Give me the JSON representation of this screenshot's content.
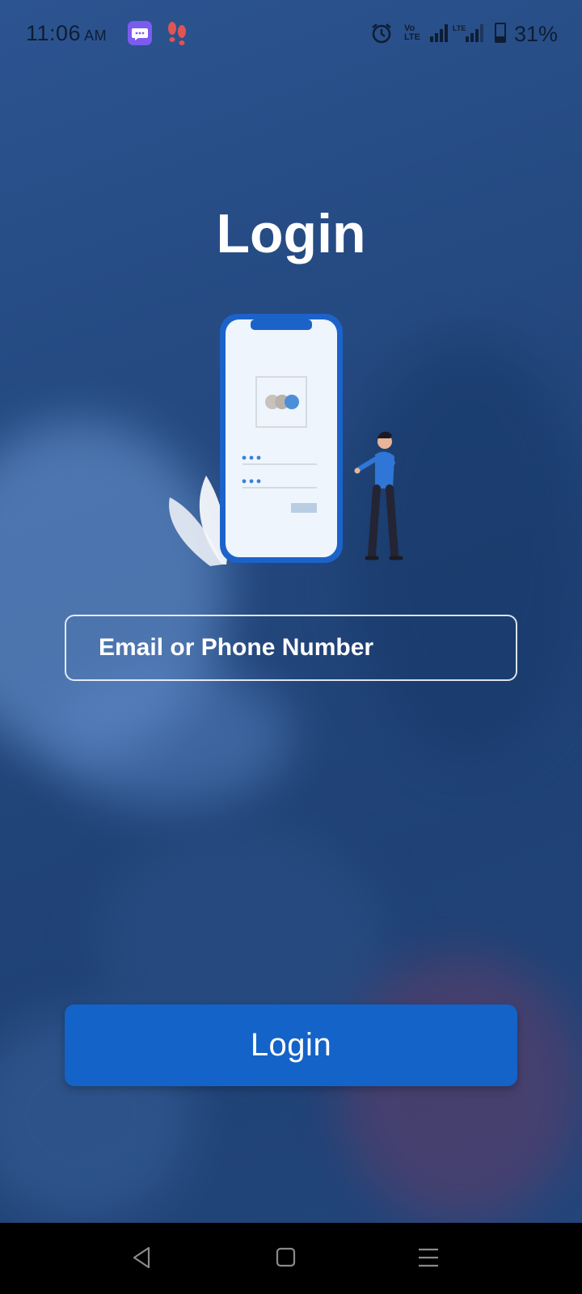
{
  "status_bar": {
    "time": "11:06",
    "ampm": "AM",
    "battery_percent_text": "31%",
    "battery_level": 0.31,
    "icons": [
      "chat-app-icon",
      "footsteps-icon",
      "alarm-icon",
      "volte-icon",
      "signal-icon",
      "lte-signal-icon",
      "battery-icon"
    ]
  },
  "page": {
    "title": "Login"
  },
  "form": {
    "email_placeholder": "Email or Phone Number",
    "login_button": "Login"
  },
  "nav_bar": {
    "icons": [
      "back-icon",
      "home-icon",
      "menu-icon"
    ]
  },
  "colors": {
    "primary": "#1463c8",
    "background": "#22457a",
    "text": "#ffffff"
  }
}
